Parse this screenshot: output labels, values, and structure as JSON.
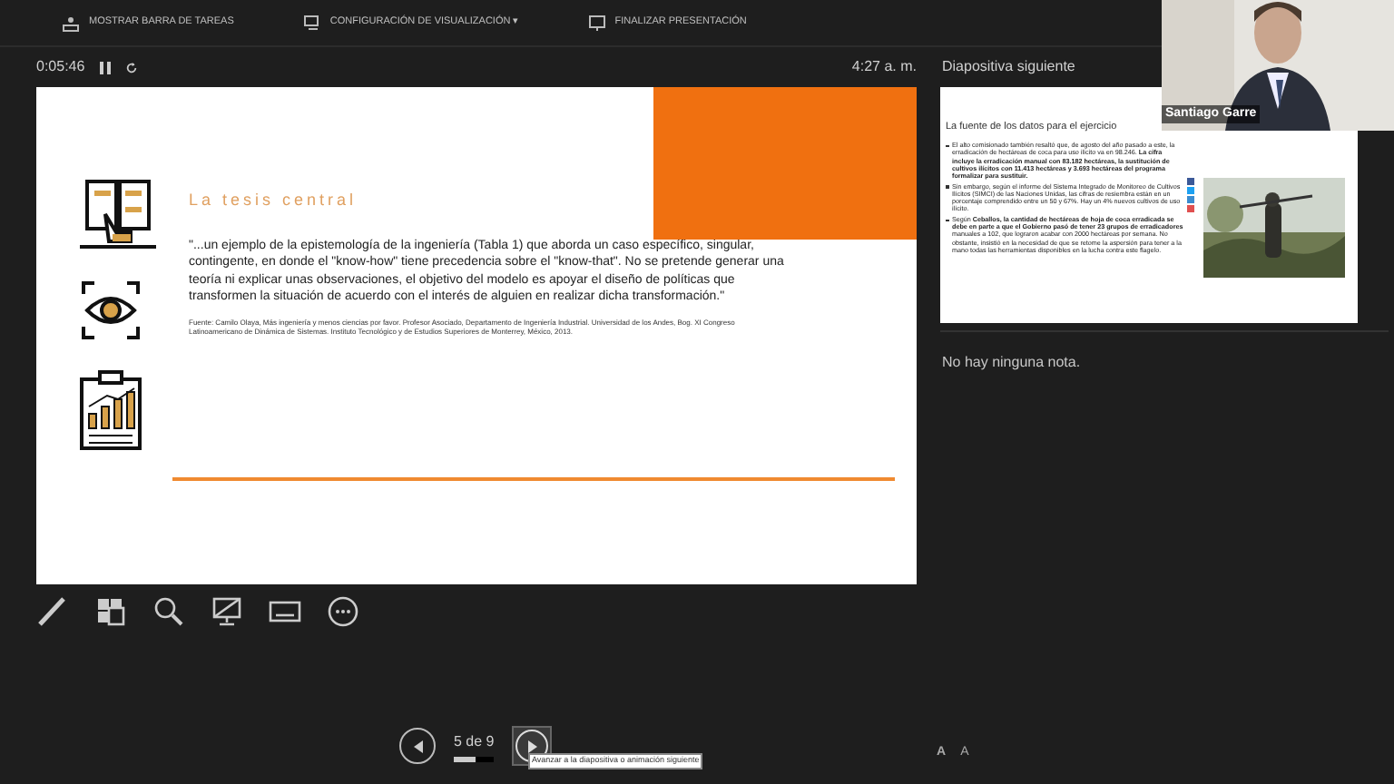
{
  "toolbar": [
    {
      "kind": "taskbar",
      "label": "MOSTRAR BARRA DE TAREAS"
    },
    {
      "kind": "display",
      "label": "CONFIGURACIÓN DE VISUALIZACIÓN ▾"
    },
    {
      "kind": "end",
      "label": "FINALIZAR PRESENTACIÓN"
    }
  ],
  "timer": "0:05:46",
  "clock": "4:27 a. m.",
  "slide": {
    "title": "La tesis central",
    "quote": "\"...un ejemplo de la epistemología de la ingeniería (Tabla 1) que aborda un caso específico, singular, contingente, en donde el \"know-how\" tiene precedencia sobre el \"know-that\". No se pretende generar una teoría ni explicar unas observaciones, el objetivo del modelo es apoyar el diseño de políticas que transformen la situación de acuerdo con el interés de alguien en realizar dicha transformación.\"",
    "source": "Fuente: Camilo Olaya, Más ingeniería y menos ciencias por favor. Profesor Asociado, Departamento de Ingeniería Industrial. Universidad de los Andes, Bog. XI Congreso Latinoamericano de Dinámica de Sistemas. Instituto Tecnológico y de Estudios Superiores de Monterrey, México, 2013."
  },
  "next_slide": {
    "heading": "Diapositiva siguiente",
    "title": "La fuente de los datos para el ejercicio",
    "bullets": [
      "El alto comisionado también resaltó que, de agosto del año pasado a este, la erradicación de hectáreas de coca para uso ilícito va en 98.246. **La cifra incluye la erradicación manual con 83.182 hectáreas, la sustitución de cultivos ilícitos con 11.413 hectáreas y 3.693 hectáreas del programa formalizar para sustituir.**",
      "Sin embargo, según el informe del Sistema Integrado de Monitoreo de Cultivos Ilícitos (SIMCI) de las Naciones Unidas, las cifras de resiembra están en un porcentaje comprendido entre un 50 y 67%. Hay un 4% nuevos cultivos de uso ilícito.",
      "Según **Ceballos, la cantidad de hectáreas de hoja de coca erradicada se debe en parte a que el Gobierno pasó de tener 23 grupos de erradicadores** manuales a 102, que lograron acabar con 2000 hectáreas por semana. No obstante, insistió en la necesidad de que se retome la aspersión para tener a la mano todas las herramientas disponibles en la lucha contra este flagelo."
    ]
  },
  "notes": "No hay ninguna nota.",
  "webcam": {
    "name": "Santiago Garre"
  },
  "tools": [
    {
      "kind": "pen"
    },
    {
      "kind": "slides"
    },
    {
      "kind": "zoom"
    },
    {
      "kind": "black"
    },
    {
      "kind": "subtitles"
    },
    {
      "kind": "more"
    }
  ],
  "nav": {
    "counter": "5 de 9",
    "level": 0.55,
    "tooltip": "Avanzar a la diapositiva o animación siguiente"
  },
  "font_buttons": [
    {
      "kind": "larger",
      "label": "A"
    },
    {
      "kind": "smaller",
      "label": "A"
    }
  ]
}
